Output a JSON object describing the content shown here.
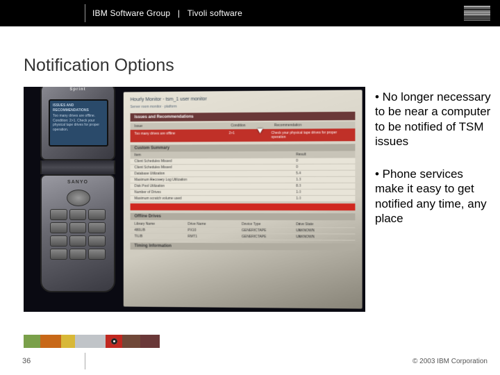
{
  "header": {
    "group": "IBM Software Group",
    "separator": "|",
    "product": "Tivoli software",
    "logo_name": "IBM"
  },
  "title": "Notification Options",
  "bullets": [
    "• No longer necessary to be near a computer to be notified of TSM issues",
    "• Phone services make it easy to get notified any time, any place"
  ],
  "photo": {
    "phone": {
      "carrier": "Sprint",
      "brand": "SANYO",
      "screen_heading": "ISSUES AND RECOMMENDATIONS",
      "screen_body": "Too many drives are offline. Condition: 2>1. Check your physical tape drives for proper operation."
    },
    "monitor": {
      "title_line": "Hourly Monitor - tsm_1 user monitor",
      "server_line": "Server room monitor · platform",
      "section_issues": "Issues and Recommendations",
      "columns": {
        "c1": "Issue",
        "c2": "Condition",
        "c3": "Recommendation"
      },
      "issue_row": {
        "c1": "Too many drives are offline",
        "c2": "2>1",
        "c3": "Check your physical tape drives for proper operation"
      },
      "section_summary": "Custom Summary",
      "summary_head": {
        "c1": "Item",
        "c2": "Result"
      },
      "summary_rows": [
        {
          "label": "Client Schedules Missed",
          "val": "0"
        },
        {
          "label": "Client Schedules Missed",
          "val": "0"
        },
        {
          "label": "Database Utilization",
          "val": "5.4"
        },
        {
          "label": "Maximum Recovery Log Utilization",
          "val": "1.3"
        },
        {
          "label": "Disk Pool Utilization",
          "val": "8.3"
        },
        {
          "label": "Number of Drives",
          "val": "1.0"
        },
        {
          "label": "Maximum scratch volume used",
          "val": "1.0"
        }
      ],
      "section_offline": "Offline Drives",
      "drive_head": {
        "c1": "Library Name",
        "c2": "Drive Name",
        "c3": "Device Type",
        "c4": "Drive State"
      },
      "drive_rows": [
        {
          "c1": "480LIB",
          "c2": "PX10",
          "c3": "GENERICTAPE",
          "c4": "UNKNOWN"
        },
        {
          "c1": "TILIB",
          "c2": "RMT1",
          "c3": "GENERICTAPE",
          "c4": "UNKNOWN"
        }
      ],
      "section_timing": "Timing Information"
    }
  },
  "accent_colors": [
    "#7aa04a",
    "#c86818",
    "#d8b838",
    "#c0c4c8",
    "#c02820",
    "#704838",
    "#6a3838"
  ],
  "footer": {
    "slide_number": "36",
    "copyright": "© 2003 IBM Corporation"
  }
}
